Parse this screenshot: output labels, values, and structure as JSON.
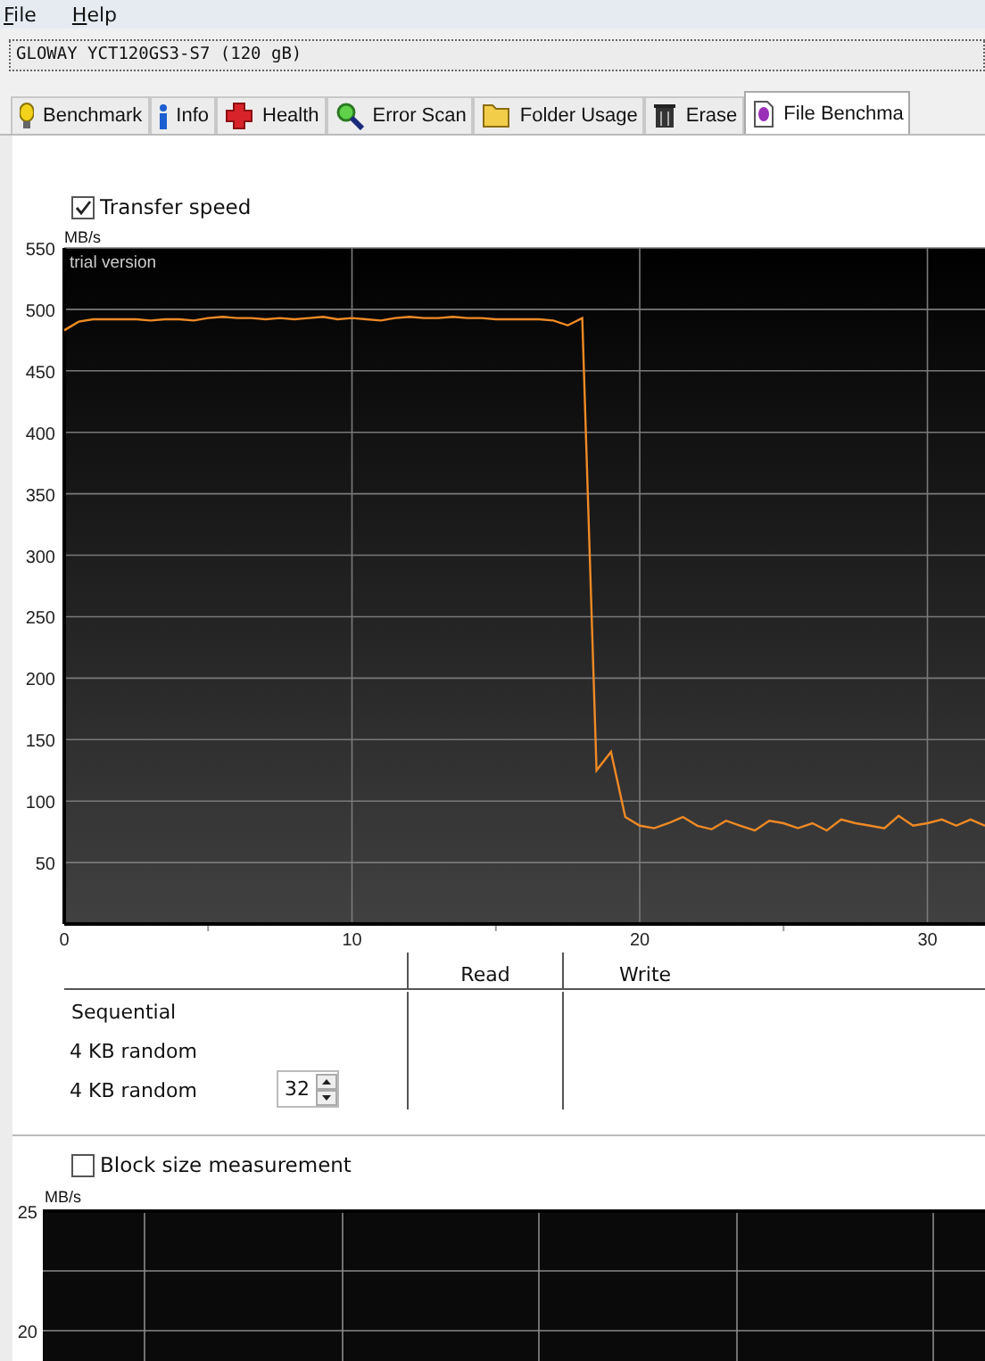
{
  "menu": [
    {
      "label": "File"
    },
    {
      "label": "Help"
    }
  ],
  "drive": {
    "value": "GLOWAY YCT120GS3-S7 (120 gB)"
  },
  "tabs": [
    {
      "label": "Benchmark",
      "selected": false
    },
    {
      "label": "Info",
      "selected": false
    },
    {
      "label": "Health",
      "selected": false
    },
    {
      "label": "Error Scan",
      "selected": false
    },
    {
      "label": "Folder Usage",
      "selected": false
    },
    {
      "label": "Erase",
      "selected": false
    },
    {
      "label": "File Benchma",
      "selected": true
    }
  ],
  "transfer_speed": {
    "label": "Transfer speed",
    "checked": true,
    "chart_data": {
      "type": "line",
      "grid": true,
      "ylabel": "MB/s",
      "xlim": [
        0,
        32
      ],
      "ylim": [
        0,
        550
      ],
      "xticks": [
        0,
        10,
        20,
        30
      ],
      "yticks": [
        50,
        100,
        150,
        200,
        250,
        300,
        350,
        400,
        450,
        500,
        550
      ],
      "annotations": [
        "trial version"
      ],
      "x": [
        0,
        0.5,
        1,
        1.5,
        2,
        2.5,
        3,
        3.5,
        4,
        4.5,
        5,
        5.5,
        6,
        6.5,
        7,
        7.5,
        8,
        8.5,
        9,
        9.5,
        10,
        10.5,
        11,
        11.5,
        12,
        12.5,
        13,
        13.5,
        14,
        14.5,
        15,
        15.5,
        16,
        16.5,
        17,
        17.5,
        18,
        18.5,
        19,
        19.5,
        20,
        20.5,
        21,
        21.5,
        22,
        22.5,
        23,
        23.5,
        24,
        24.5,
        25,
        25.5,
        26,
        26.5,
        27,
        27.5,
        28,
        28.5,
        29,
        29.5,
        30,
        30.5,
        31,
        31.5,
        32
      ],
      "series": [
        {
          "color": "#f08a24",
          "values": [
            483,
            490,
            492,
            492,
            492,
            492,
            491,
            492,
            492,
            491,
            493,
            494,
            493,
            493,
            492,
            493,
            492,
            493,
            494,
            492,
            493,
            492,
            491,
            493,
            494,
            493,
            493,
            494,
            493,
            493,
            492,
            492,
            492,
            492,
            491,
            487,
            493,
            125,
            140,
            87,
            80,
            78,
            82,
            87,
            80,
            77,
            84,
            80,
            76,
            84,
            82,
            78,
            82,
            76,
            85,
            82,
            80,
            78,
            88,
            80,
            82,
            85,
            80,
            85,
            80
          ]
        }
      ]
    }
  },
  "results": {
    "columns": [
      "Read",
      "Write"
    ],
    "rows": [
      {
        "label": "Sequential",
        "kind": "plain"
      },
      {
        "label": "4 KB random",
        "kind": "plain"
      },
      {
        "label": "4 KB random",
        "kind": "spinner",
        "value": "32"
      }
    ]
  },
  "block_size": {
    "label": "Block size measurement",
    "checked": false,
    "ylabel": "MB/s",
    "yticks": [
      "25",
      "20"
    ]
  }
}
